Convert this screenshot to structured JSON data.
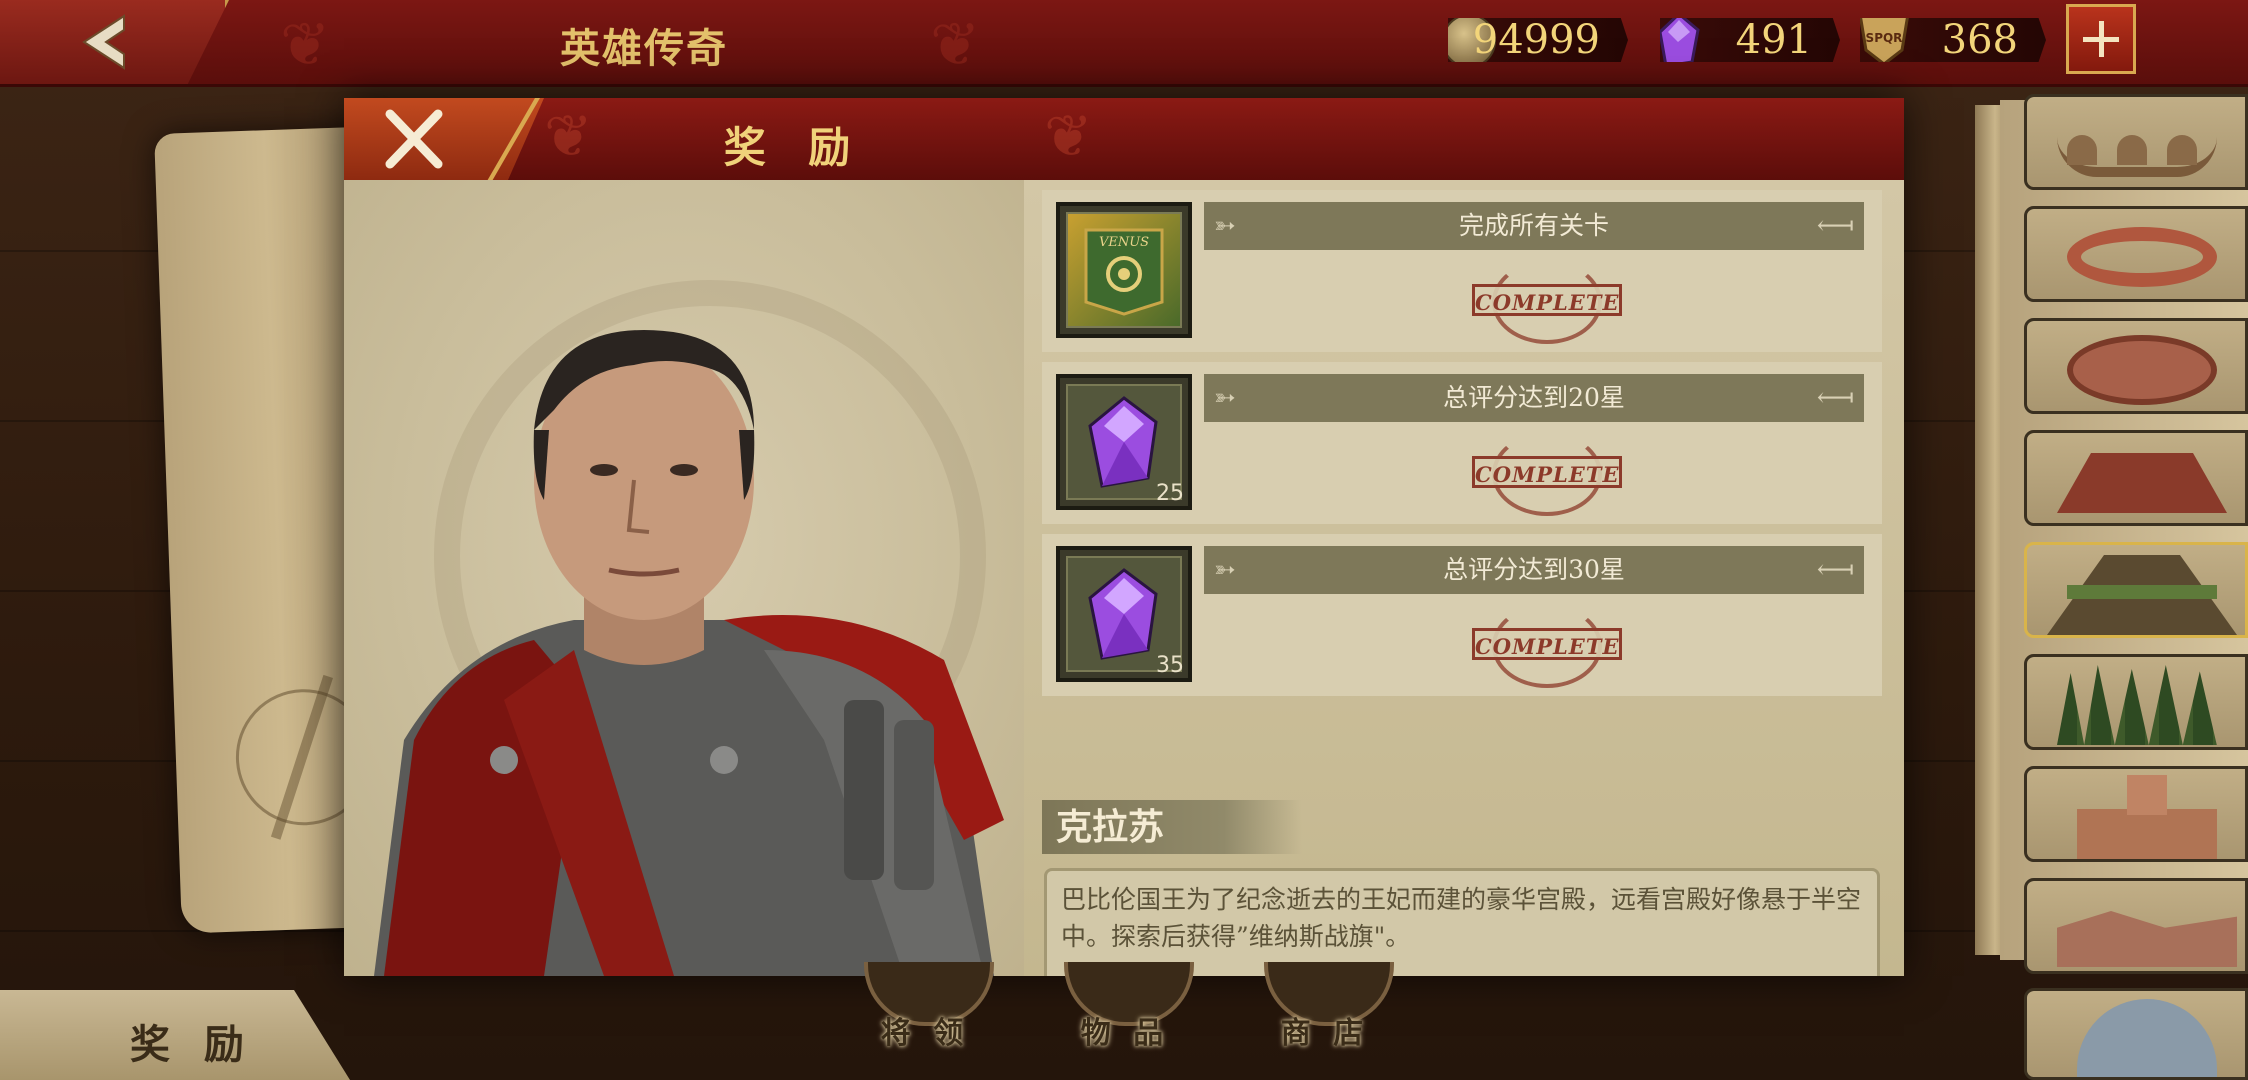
{
  "header": {
    "title": "英雄传奇",
    "back_icon": "chevron-left-icon"
  },
  "resources": {
    "coins": "94999",
    "gems": "491",
    "tokens": "368",
    "token_icon_text": "SPQR",
    "add_icon": "plus-icon"
  },
  "dialog": {
    "title": "奖 励",
    "close_icon": "close-icon",
    "rewards": [
      {
        "icon": "venus-banner-icon",
        "banner_text": "VENUS",
        "quantity": "",
        "condition": "完成所有关卡",
        "status": "COMPLETE"
      },
      {
        "icon": "purple-gem-icon",
        "quantity": "25",
        "condition": "总评分达到20星",
        "status": "COMPLETE"
      },
      {
        "icon": "purple-gem-icon",
        "quantity": "35",
        "condition": "总评分达到30星",
        "status": "COMPLETE"
      }
    ],
    "hero_name": "克拉苏",
    "hero_description": "巴比伦国王为了纪念逝去的王妃而建的豪华宫殿，远看宫殿好像悬于半空中。探索后获得”维纳斯战旗\"。"
  },
  "bottom": {
    "rewards_tab": "奖 励",
    "nav": [
      {
        "label": "将 领"
      },
      {
        "label": "物 品"
      },
      {
        "label": "商 店"
      }
    ]
  },
  "colors": {
    "header_red": "#7c1713",
    "gold_text": "#e3c16b",
    "gem_purple": "#9b4de0",
    "stamp_red": "#8c3a2a"
  }
}
